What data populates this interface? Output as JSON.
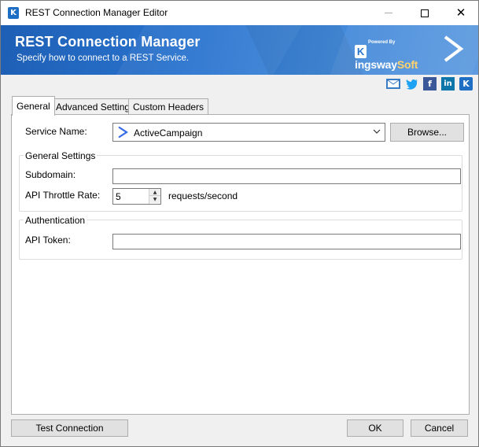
{
  "window": {
    "title": "REST Connection Manager Editor",
    "app_icon_letter": "K"
  },
  "banner": {
    "title": "REST Connection Manager",
    "subtitle": "Specify how to connect to a REST Service.",
    "brand_powered": "Powered By",
    "brand_k": "K",
    "brand_ingsway": "ingsway",
    "brand_soft": "Soft"
  },
  "social": {
    "icons": [
      "mail-icon",
      "twitter-icon",
      "facebook-icon",
      "linkedin-icon",
      "kingswaysoft-icon"
    ],
    "facebook_letter": "f",
    "linkedin_letter": "in",
    "kingsway_letter": "K"
  },
  "tabs": [
    {
      "label": "General",
      "active": true
    },
    {
      "label": "Advanced Settings",
      "active": false
    },
    {
      "label": "Custom Headers",
      "active": false
    }
  ],
  "general": {
    "service_name_label": "Service Name:",
    "service_name_value": "ActiveCampaign",
    "browse_label": "Browse...",
    "general_settings_title": "General Settings",
    "subdomain_label": "Subdomain:",
    "subdomain_value": "",
    "throttle_label": "API Throttle Rate:",
    "throttle_value": "5",
    "throttle_unit": "requests/second",
    "authentication_title": "Authentication",
    "api_token_label": "API Token:",
    "api_token_value": ""
  },
  "footer": {
    "test_connection_label": "Test Connection",
    "ok_label": "OK",
    "cancel_label": "Cancel"
  },
  "colors": {
    "banner_blue": "#2a74cf",
    "brand_accent": "#ffd36b",
    "active_campaign_blue": "#356ae6"
  }
}
